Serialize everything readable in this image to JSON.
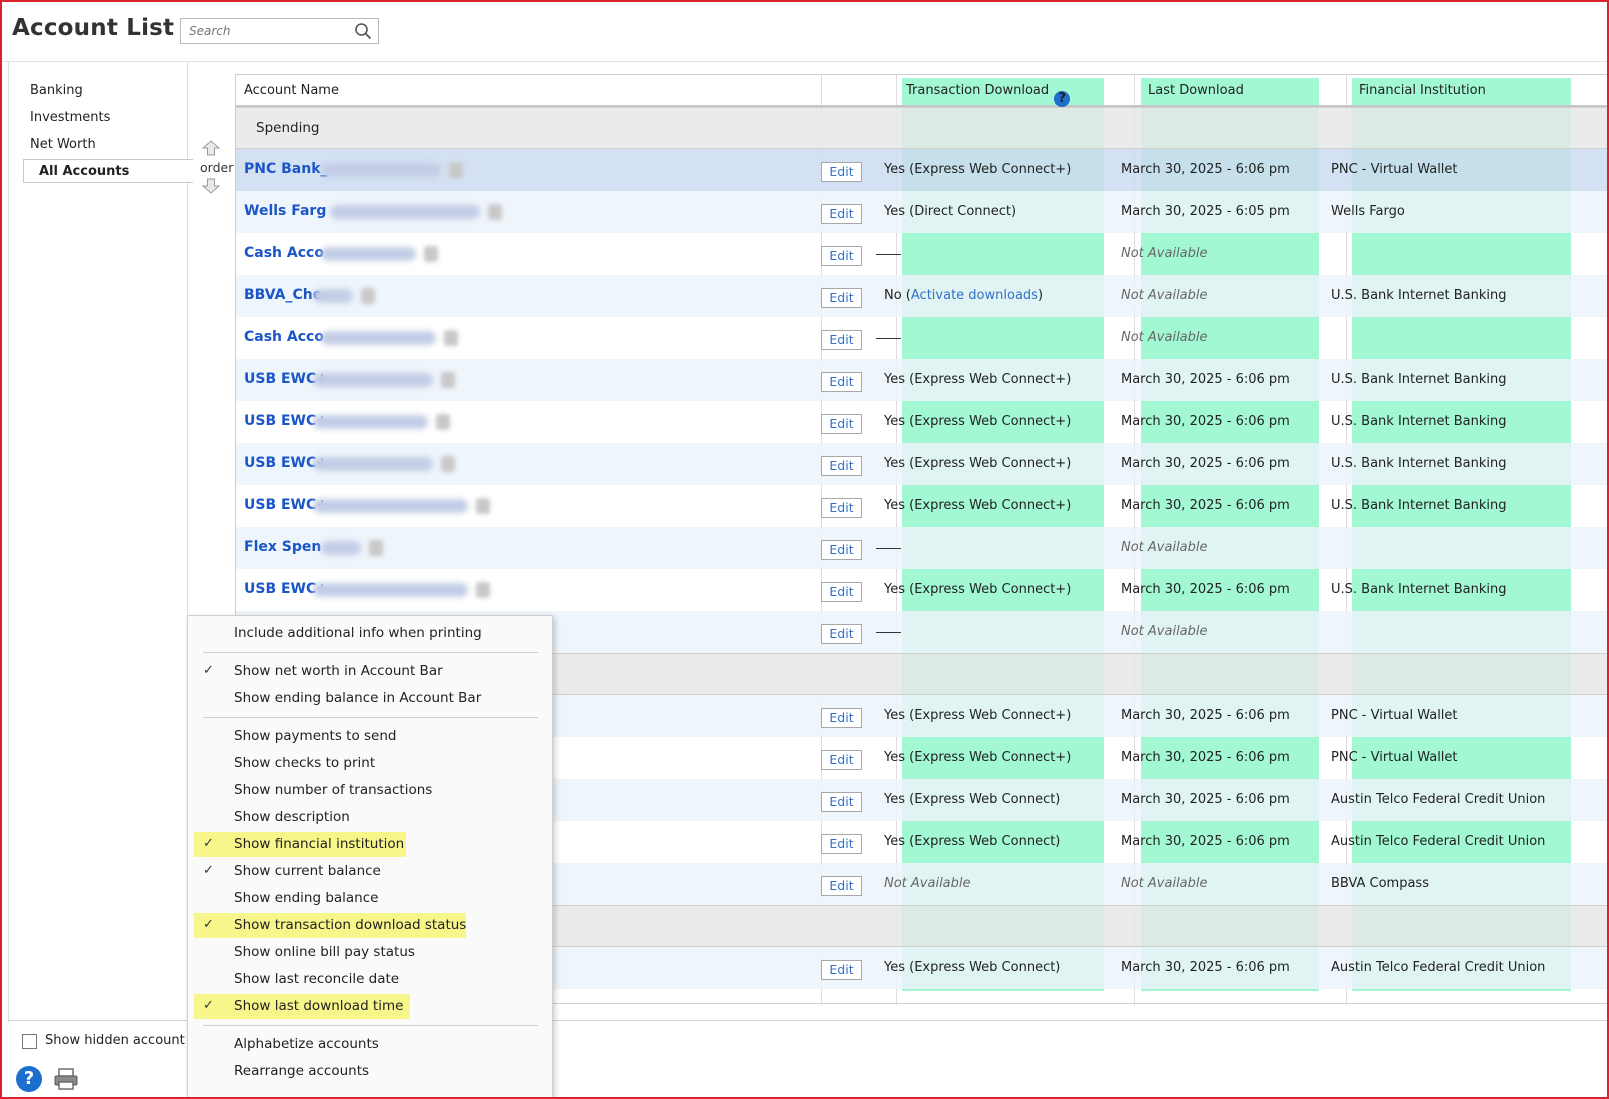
{
  "window": {
    "title": "Account List"
  },
  "search": {
    "placeholder": "Search"
  },
  "sidebar": {
    "items": [
      {
        "label": "Banking",
        "active": false
      },
      {
        "label": "Investments",
        "active": false
      },
      {
        "label": "Net Worth",
        "active": false
      },
      {
        "label": "All Accounts",
        "active": true
      }
    ],
    "order_label": "order"
  },
  "table": {
    "headers": {
      "account_name": "Account Name",
      "transaction_download": "Transaction Download",
      "last_download": "Last Download",
      "financial_institution": "Financial Institution"
    },
    "groups": [
      {
        "label": "Spending"
      }
    ],
    "rows": [
      {
        "name": "PNC Bank_",
        "edit": "Edit",
        "td": "Yes (Express Web Connect+)",
        "ld": "March 30, 2025 - 6:06 pm",
        "fi": "PNC - Virtual Wallet"
      },
      {
        "name": "Wells Farg",
        "edit": "Edit",
        "td": "Yes (Direct Connect)",
        "ld": "March 30, 2025 - 6:05 pm",
        "fi": "Wells Fargo"
      },
      {
        "name": "Cash Acco",
        "edit": "Edit",
        "td": "",
        "ld": "Not Available",
        "fi": ""
      },
      {
        "name": "BBVA_Che",
        "edit": "Edit",
        "td_prefix": "No (",
        "td_link": "Activate downloads",
        "td_suffix": ")",
        "ld": "Not Available",
        "fi": "U.S. Bank Internet Banking"
      },
      {
        "name": "Cash Acco",
        "edit": "Edit",
        "td": "",
        "ld": "Not Available",
        "fi": ""
      },
      {
        "name": "USB EWC+",
        "edit": "Edit",
        "td": "Yes (Express Web Connect+)",
        "ld": "March 30, 2025 - 6:06 pm",
        "fi": "U.S. Bank Internet Banking"
      },
      {
        "name": "USB EWC+",
        "edit": "Edit",
        "td": "Yes (Express Web Connect+)",
        "ld": "March 30, 2025 - 6:06 pm",
        "fi": "U.S. Bank Internet Banking"
      },
      {
        "name": "USB EWC+",
        "edit": "Edit",
        "td": "Yes (Express Web Connect+)",
        "ld": "March 30, 2025 - 6:06 pm",
        "fi": "U.S. Bank Internet Banking"
      },
      {
        "name": "USB EWC+",
        "edit": "Edit",
        "td": "Yes (Express Web Connect+)",
        "ld": "March 30, 2025 - 6:06 pm",
        "fi": "U.S. Bank Internet Banking"
      },
      {
        "name": "Flex Spen",
        "edit": "Edit",
        "td": "",
        "ld": "Not Available",
        "fi": ""
      },
      {
        "name": "USB EWC+",
        "edit": "Edit",
        "td": "Yes (Express Web Connect+)",
        "ld": "March 30, 2025 - 6:06 pm",
        "fi": "U.S. Bank Internet Banking"
      },
      {
        "name": "",
        "edit": "Edit",
        "td": "",
        "ld": "Not Available",
        "fi": ""
      },
      {
        "name": "",
        "edit": "Edit",
        "td": "Yes (Express Web Connect+)",
        "ld": "March 30, 2025 - 6:06 pm",
        "fi": "PNC - Virtual Wallet"
      },
      {
        "name": "",
        "edit": "Edit",
        "td": "Yes (Express Web Connect+)",
        "ld": "March 30, 2025 - 6:06 pm",
        "fi": "PNC - Virtual Wallet"
      },
      {
        "name": "",
        "edit": "Edit",
        "td": "Yes (Express Web Connect)",
        "ld": "March 30, 2025 - 6:06 pm",
        "fi": "Austin Telco Federal Credit Union"
      },
      {
        "name": "",
        "edit": "Edit",
        "td": "Yes (Express Web Connect)",
        "ld": "March 30, 2025 - 6:06 pm",
        "fi": "Austin Telco Federal Credit Union"
      },
      {
        "name": "",
        "edit": "Edit",
        "td": "Not Available",
        "ld": "Not Available",
        "fi": "BBVA Compass"
      },
      {
        "name": "",
        "edit": "Edit",
        "td": "Yes (Express Web Connect)",
        "ld": "March 30, 2025 - 6:06 pm",
        "fi": "Austin Telco Federal Credit Union"
      }
    ]
  },
  "footer": {
    "show_hidden_label": "Show hidden account"
  },
  "menu": {
    "items": [
      {
        "label": "Include additional info when printing",
        "checked": false,
        "highlight": false
      },
      {
        "label": "Show net worth in Account Bar",
        "checked": true,
        "highlight": false
      },
      {
        "label": "Show ending balance in Account Bar",
        "checked": false,
        "highlight": false
      },
      {
        "label": "Show payments to send",
        "checked": false,
        "highlight": false
      },
      {
        "label": "Show checks to print",
        "checked": false,
        "highlight": false
      },
      {
        "label": "Show number of transactions",
        "checked": false,
        "highlight": false
      },
      {
        "label": "Show description",
        "checked": false,
        "highlight": false
      },
      {
        "label": "Show financial institution",
        "checked": true,
        "highlight": true
      },
      {
        "label": "Show current balance",
        "checked": true,
        "highlight": false
      },
      {
        "label": "Show ending balance",
        "checked": false,
        "highlight": false
      },
      {
        "label": "Show transaction download status",
        "checked": true,
        "highlight": true
      },
      {
        "label": "Show online bill pay status",
        "checked": false,
        "highlight": false
      },
      {
        "label": "Show last reconcile date",
        "checked": false,
        "highlight": false
      },
      {
        "label": "Show last download time",
        "checked": true,
        "highlight": true
      },
      {
        "label": "Alphabetize accounts",
        "checked": false,
        "highlight": false
      },
      {
        "label": "Rearrange accounts",
        "checked": false,
        "highlight": false
      }
    ],
    "check_glyph": "✓"
  },
  "colors": {
    "highlight_columns": "#97f7cd",
    "menu_highlight": "#f6f68a",
    "link": "#1a56c8",
    "frame": "#d8242c"
  }
}
